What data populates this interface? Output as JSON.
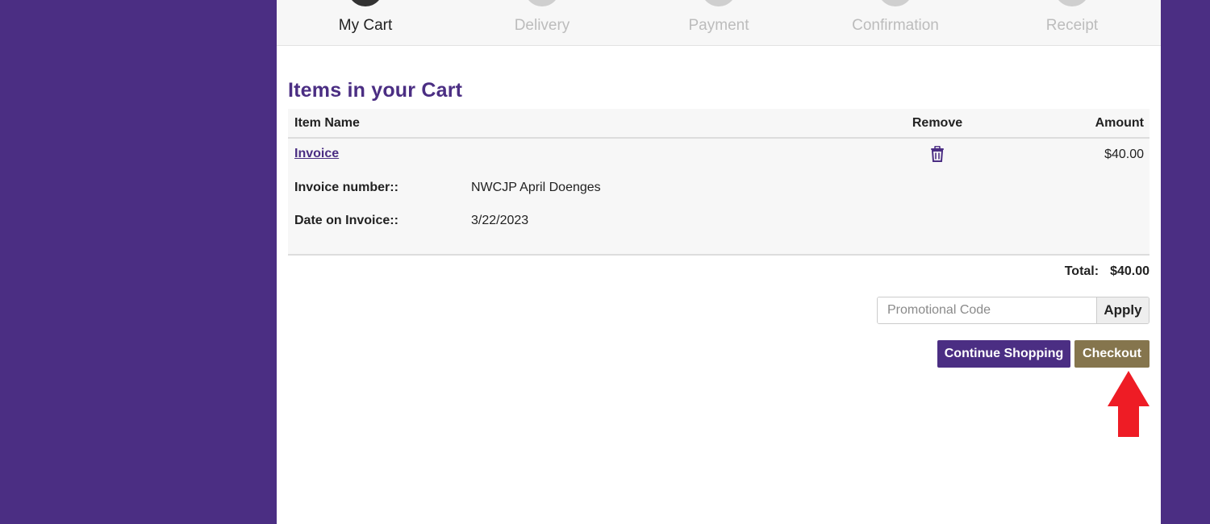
{
  "steps": [
    {
      "label": "My Cart",
      "active": true
    },
    {
      "label": "Delivery",
      "active": false
    },
    {
      "label": "Payment",
      "active": false
    },
    {
      "label": "Confirmation",
      "active": false
    },
    {
      "label": "Receipt",
      "active": false
    }
  ],
  "cart": {
    "title": "Items in your Cart",
    "columns": {
      "name": "Item Name",
      "remove": "Remove",
      "amount": "Amount"
    },
    "item": {
      "name": "Invoice",
      "amount": "$40.00",
      "remove_icon": "trash-icon",
      "fields": [
        {
          "label": "Invoice number::",
          "value": "NWCJP April Doenges"
        },
        {
          "label": "Date on Invoice::",
          "value": "3/22/2023"
        }
      ]
    },
    "total_label": "Total:",
    "total_value": "$40.00"
  },
  "promo": {
    "placeholder": "Promotional Code",
    "value": "",
    "apply_label": "Apply"
  },
  "actions": {
    "continue_label": "Continue Shopping",
    "checkout_label": "Checkout"
  },
  "annotation": {
    "icon": "red-arrow-up-icon",
    "color": "#ee1c25"
  },
  "colors": {
    "brand_purple": "#4b2e83",
    "gold": "#85754d"
  }
}
